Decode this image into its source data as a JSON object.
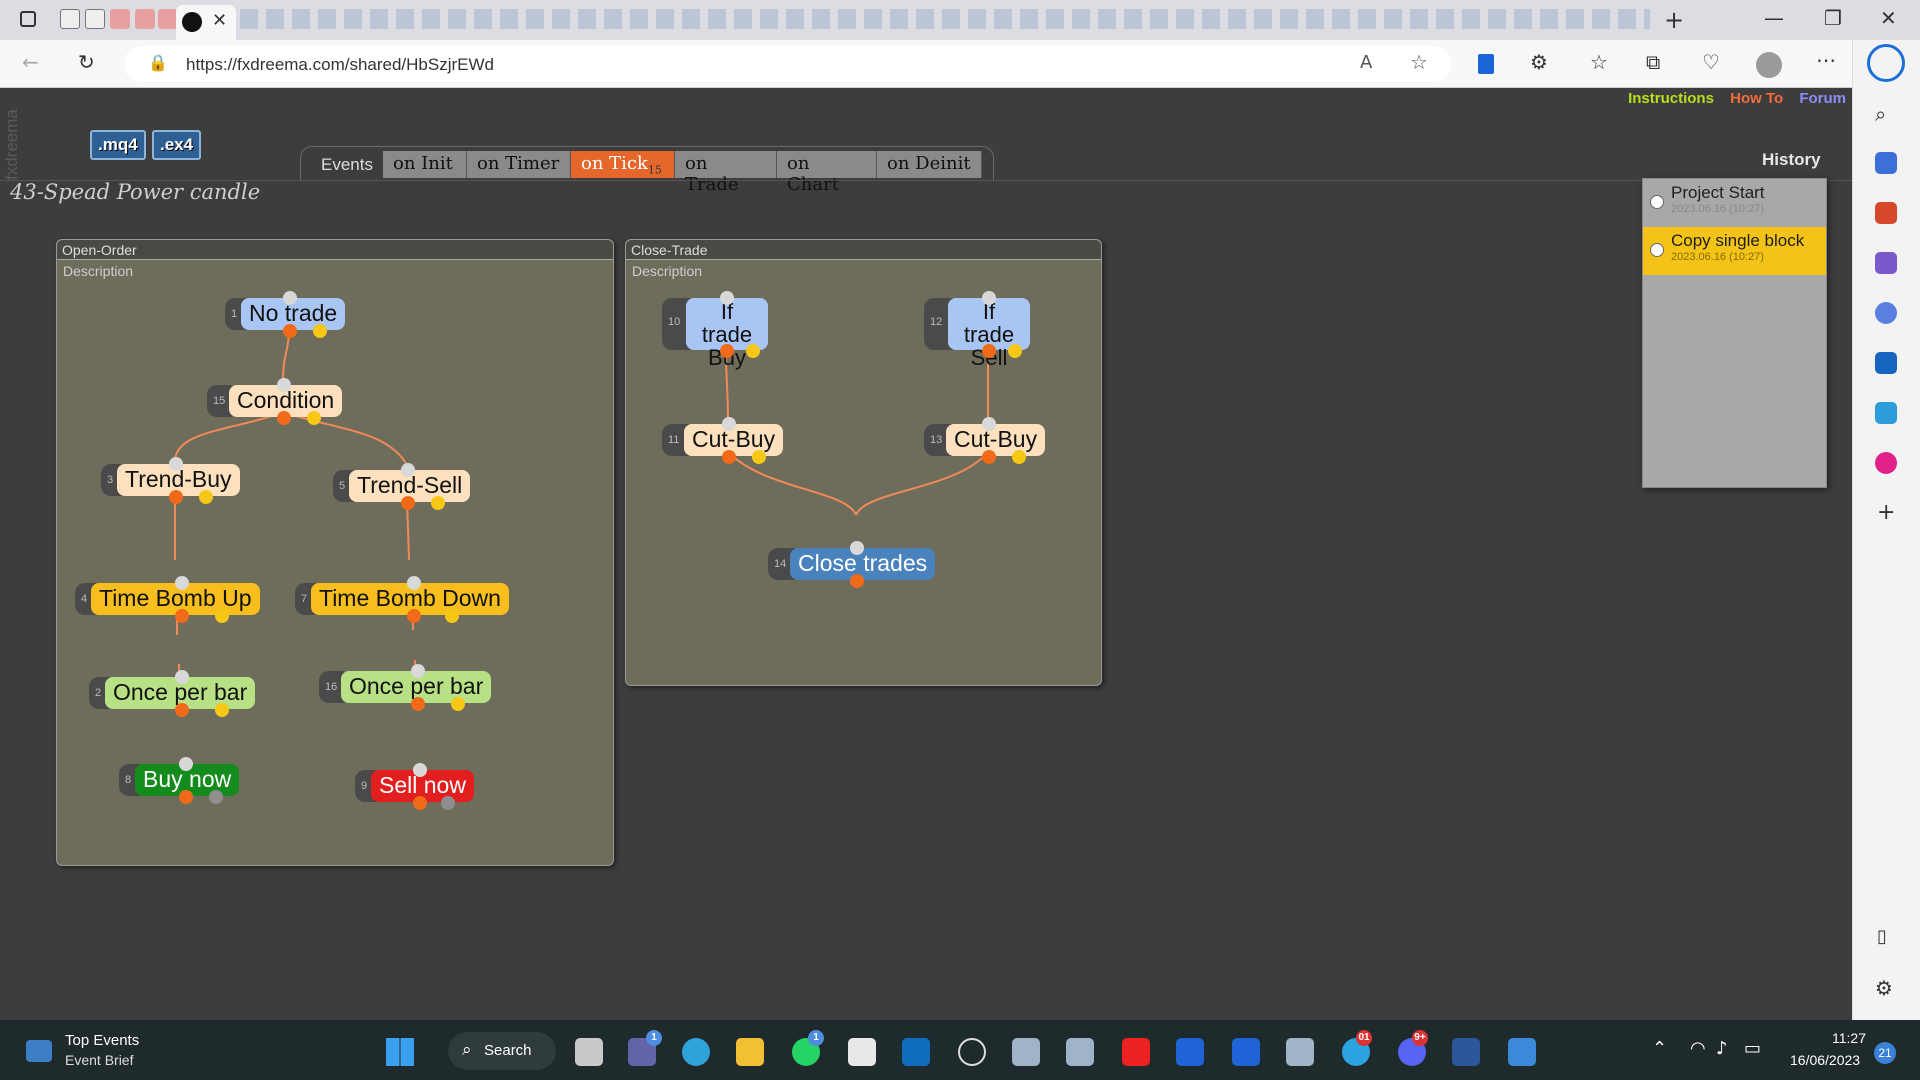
{
  "browser": {
    "url": "https://fxdreema.com/shared/HbSzjrEWd",
    "tabs_icons": [
      "square-icon",
      "doc-icon",
      "doc-icon",
      "pencil-icon",
      "pencil-icon",
      "pencil-icon",
      "circle-icon"
    ]
  },
  "page": {
    "brand": "fxdreema",
    "file_buttons": [
      ".mq4",
      ".ex4"
    ],
    "project_title": "43-Spead Power candle",
    "top_links": [
      {
        "label": "Instructions",
        "color": "#b6e01c"
      },
      {
        "label": "How To",
        "color": "#f26b3a"
      },
      {
        "label": "Forum",
        "color": "#8c8cf5"
      }
    ],
    "events_label": "Events",
    "event_tabs": [
      {
        "label": "on Init",
        "active": false,
        "badge": ""
      },
      {
        "label": "on Timer",
        "active": false,
        "badge": ""
      },
      {
        "label": "on Tick",
        "active": true,
        "badge": "15"
      },
      {
        "label": "on Trade",
        "active": false,
        "badge": ""
      },
      {
        "label": "on Chart",
        "active": false,
        "badge": ""
      },
      {
        "label": "on Deinit",
        "active": false,
        "badge": ""
      }
    ]
  },
  "history": {
    "title": "History",
    "items": [
      {
        "label": "Project Start",
        "date": "2023.06.16 (10:27)",
        "selected": false
      },
      {
        "label": "Copy single block",
        "date": "2023.06.16 (10:27)",
        "selected": true
      }
    ]
  },
  "panels": {
    "open_order": {
      "title": "Open-Order",
      "description": "Description",
      "blocks": [
        {
          "id": "1",
          "label": "No trade",
          "color": "blue"
        },
        {
          "id": "15",
          "label": "Condition",
          "color": "peach"
        },
        {
          "id": "3",
          "label": "Trend-Buy",
          "color": "peach"
        },
        {
          "id": "5",
          "label": "Trend-Sell",
          "color": "peach"
        },
        {
          "id": "4",
          "label": "Time Bomb Up",
          "color": "yellow"
        },
        {
          "id": "7",
          "label": "Time Bomb Down",
          "color": "yellow"
        },
        {
          "id": "2",
          "label": "Once per bar",
          "color": "green"
        },
        {
          "id": "16",
          "label": "Once per bar",
          "color": "green"
        },
        {
          "id": "8",
          "label": "Buy now",
          "color": "darkgreen"
        },
        {
          "id": "9",
          "label": "Sell now",
          "color": "red"
        }
      ]
    },
    "close_trade": {
      "title": "Close-Trade",
      "description": "Description",
      "blocks": [
        {
          "id": "10",
          "label": "If trade Buy",
          "color": "blue"
        },
        {
          "id": "12",
          "label": "If trade Sell",
          "color": "blue"
        },
        {
          "id": "11",
          "label": "Cut-Buy",
          "color": "peach"
        },
        {
          "id": "13",
          "label": "Cut-Buy",
          "color": "peach"
        },
        {
          "id": "14",
          "label": "Close trades",
          "color": "steel"
        }
      ]
    }
  },
  "taskbar": {
    "widget_title": "Top Events",
    "widget_subtitle": "Event Brief",
    "search_label": "Search",
    "badges": {
      "teams": "1",
      "whatsapp": "1",
      "telegram": "01",
      "discord": "9+"
    },
    "time": "11:27",
    "date": "16/06/2023",
    "notifications": "21"
  }
}
